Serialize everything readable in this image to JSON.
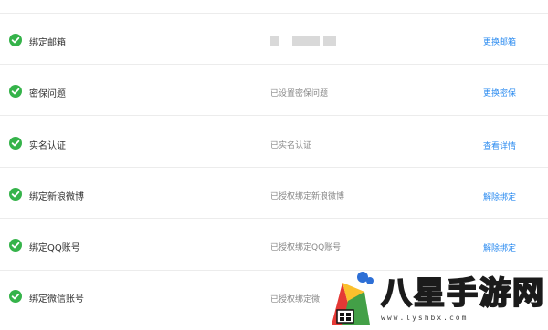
{
  "rows": [
    {
      "label": "绑定邮箱",
      "status": "",
      "action": "更换邮箱"
    },
    {
      "label": "密保问题",
      "status": "已设置密保问题",
      "action": "更换密保"
    },
    {
      "label": "实名认证",
      "status": "已实名认证",
      "action": "查看详情"
    },
    {
      "label": "绑定新浪微博",
      "status": "已授权绑定新浪微博",
      "action": "解除绑定"
    },
    {
      "label": "绑定QQ账号",
      "status": "已授权绑定QQ账号",
      "action": "解除绑定"
    },
    {
      "label": "绑定微信账号",
      "status": "已授权绑定微",
      "action": ""
    }
  ],
  "watermark": {
    "brand": "八星手游网",
    "url": "www.lyshbx.com"
  },
  "colors": {
    "check": "#35b34a",
    "action": "#2d8cf0"
  },
  "icons": {
    "row_status": "check-circle-icon"
  }
}
